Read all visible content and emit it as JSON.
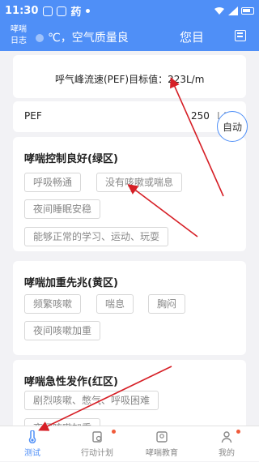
{
  "status_bar": {
    "time": "11:30",
    "app_name": "药"
  },
  "header": {
    "logo_top": "哮喘",
    "logo_bottom": "日志",
    "weather": "℃，空气质量良",
    "title": "您目"
  },
  "pef_target": {
    "label": "呼气峰流速(PEF)目标值：223L/m",
    "auto_button": "自动"
  },
  "pef_input": {
    "label": "PEF",
    "value": "250",
    "unit": "L/m"
  },
  "zones": [
    {
      "title": "哮喘控制良好(绿区)",
      "chips": [
        "呼吸畅通",
        "没有咳嗽或喘息",
        "夜间睡眠安稳",
        "能够正常的学习、运动、玩耍"
      ]
    },
    {
      "title": "哮喘加重先兆(黄区)",
      "chips": [
        "频繁咳嗽",
        "喘息",
        "胸闷",
        "夜间咳嗽加重"
      ]
    },
    {
      "title": "哮喘急性发作(红区)",
      "chips": [
        "剧烈咳嗽、憋气、呼吸困难",
        "夜间咳嗽加重"
      ]
    }
  ],
  "tabs": [
    {
      "label": "测试",
      "active": true
    },
    {
      "label": "行动计划",
      "active": false
    },
    {
      "label": "哮喘教育",
      "active": false
    },
    {
      "label": "我的",
      "active": false
    }
  ],
  "colors": {
    "primary": "#4f8ff7",
    "annotation_arrow": "#d61f26",
    "badge": "#f05a3a"
  }
}
